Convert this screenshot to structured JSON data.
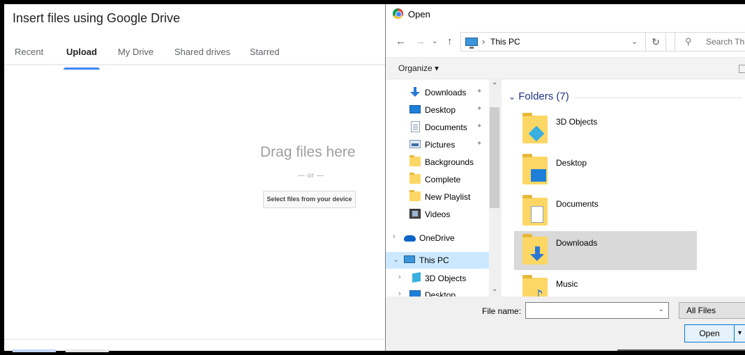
{
  "drive": {
    "title": "Insert files using Google Drive",
    "tabs": [
      "Recent",
      "Upload",
      "My Drive",
      "Shared drives",
      "Starred"
    ],
    "active_tab": "Upload",
    "drag_text": "Drag files here",
    "or_text": "— or —",
    "select_button": "Select files from your device"
  },
  "dialog": {
    "title": "Open",
    "address": {
      "separator": "›",
      "crumb": "This PC"
    },
    "search_placeholder": "Search Thi",
    "organize": "Organize ▾",
    "nav_items": [
      {
        "label": "Downloads",
        "icon": "download-icon",
        "pinned": true
      },
      {
        "label": "Desktop",
        "icon": "desktop-icon",
        "pinned": true
      },
      {
        "label": "Documents",
        "icon": "documents-icon",
        "pinned": true
      },
      {
        "label": "Pictures",
        "icon": "pictures-icon",
        "pinned": true
      },
      {
        "label": "Backgrounds",
        "icon": "folder-icon",
        "pinned": false
      },
      {
        "label": "Complete",
        "icon": "folder-icon",
        "pinned": false
      },
      {
        "label": "New Playlist",
        "icon": "folder-icon",
        "pinned": false
      },
      {
        "label": "Videos",
        "icon": "videos-icon",
        "pinned": false
      },
      {
        "label": "OneDrive",
        "icon": "onedrive-icon",
        "pinned": false
      },
      {
        "label": "This PC",
        "icon": "this-pc-icon",
        "pinned": false
      },
      {
        "label": "3D Objects",
        "icon": "3d-objects-icon",
        "pinned": false
      },
      {
        "label": "Desktop",
        "icon": "desktop-icon",
        "pinned": false
      }
    ],
    "selected_nav": "This PC",
    "group_header": "Folders (7)",
    "folders": [
      "3D Objects",
      "Desktop",
      "Documents",
      "Downloads",
      "Music"
    ],
    "selected_folder": "Downloads",
    "file_name_label": "File name:",
    "file_name_value": "",
    "file_type": "All Files",
    "open_button": "Open"
  },
  "colors": {
    "accent": "#4285f4",
    "folder": "#fcd765",
    "selection": "#cce8ff",
    "group_header": "#1e3287"
  }
}
